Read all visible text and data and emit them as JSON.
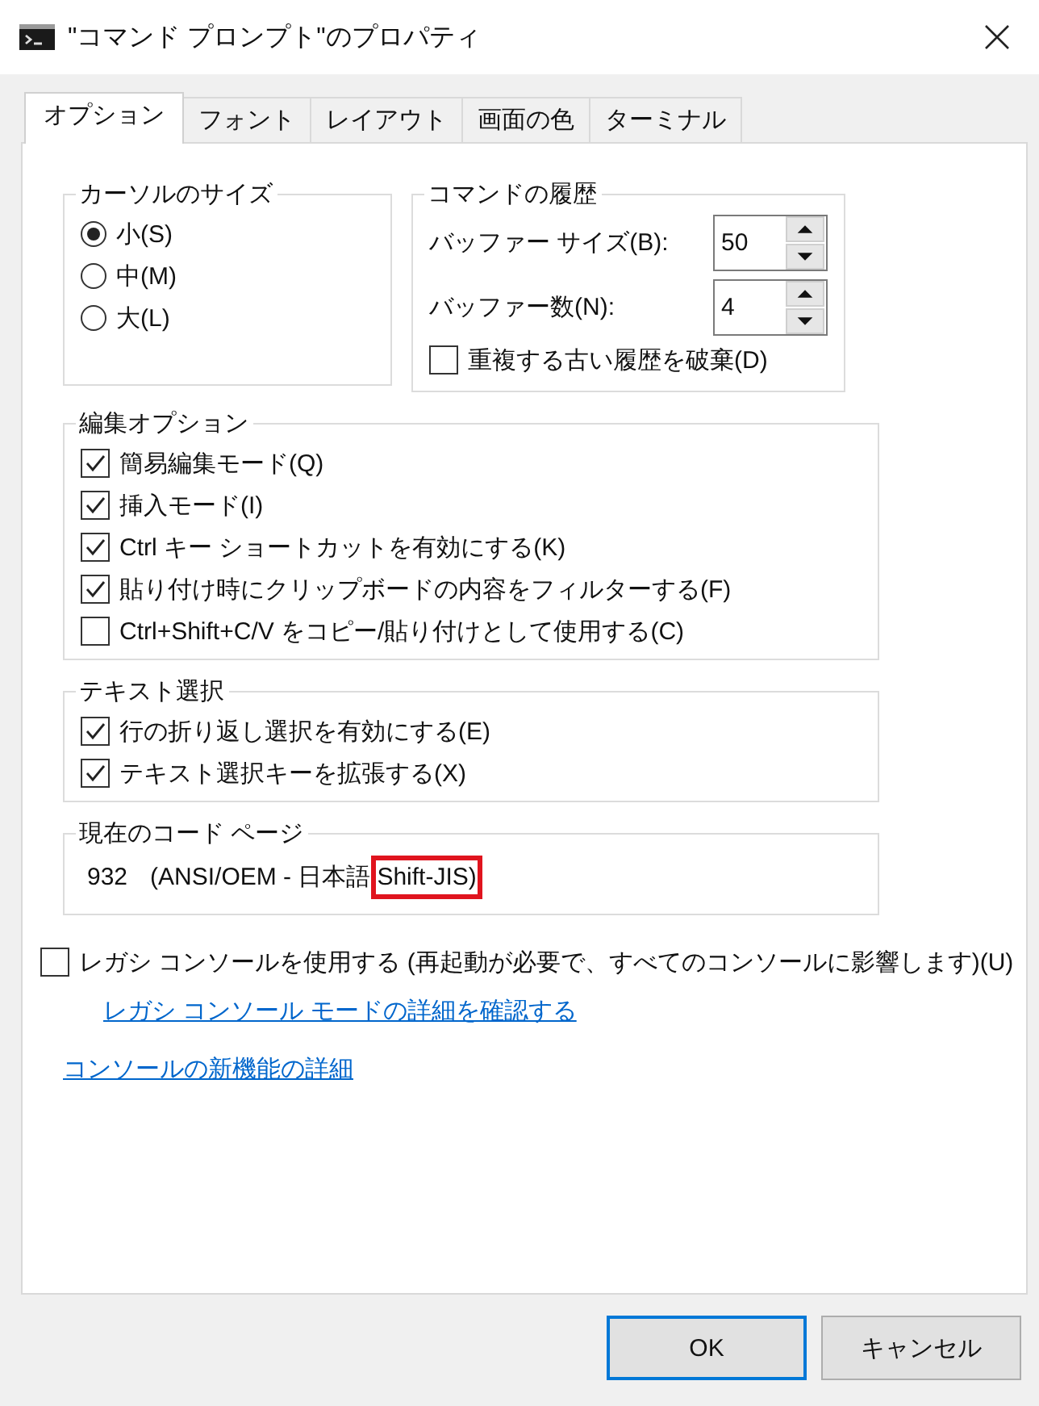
{
  "window": {
    "title": "\"コマンド プロンプト\"のプロパティ"
  },
  "tabs": [
    {
      "label": "オプション",
      "selected": true
    },
    {
      "label": "フォント",
      "selected": false
    },
    {
      "label": "レイアウト",
      "selected": false
    },
    {
      "label": "画面の色",
      "selected": false
    },
    {
      "label": "ターミナル",
      "selected": false
    }
  ],
  "cursor_size": {
    "title": "カーソルのサイズ",
    "options": [
      {
        "label": "小(S)",
        "selected": true
      },
      {
        "label": "中(M)",
        "selected": false
      },
      {
        "label": "大(L)",
        "selected": false
      }
    ]
  },
  "command_history": {
    "title": "コマンドの履歴",
    "spinners": [
      {
        "label": "バッファー サイズ(B):",
        "value": "50"
      },
      {
        "label": "バッファー数(N):",
        "value": "4"
      }
    ],
    "discard_duplicates": {
      "label": "重複する古い履歴を破棄(D)",
      "checked": false
    }
  },
  "edit_options": {
    "title": "編集オプション",
    "items": [
      {
        "label": "簡易編集モード(Q)",
        "checked": true
      },
      {
        "label": "挿入モード(I)",
        "checked": true
      },
      {
        "label": "Ctrl キー ショートカットを有効にする(K)",
        "checked": true
      },
      {
        "label": "貼り付け時にクリップボードの内容をフィルターする(F)",
        "checked": true
      },
      {
        "label": "Ctrl+Shift+C/V をコピー/貼り付けとして使用する(C)",
        "checked": false
      }
    ]
  },
  "text_selection": {
    "title": "テキスト選択",
    "items": [
      {
        "label": "行の折り返し選択を有効にする(E)",
        "checked": true
      },
      {
        "label": "テキスト選択キーを拡張する(X)",
        "checked": true
      }
    ]
  },
  "code_page": {
    "title": "現在のコード ページ",
    "number": "932",
    "description": "(ANSI/OEM - 日本語",
    "highlighted_text": "Shift-JIS)",
    "highlight": true
  },
  "legacy_console": {
    "label": "レガシ コンソールを使用する (再起動が必要で、すべてのコンソールに影響します)(U)",
    "checked": false,
    "link": "レガシ コンソール モードの詳細を確認する"
  },
  "new_features_link": "コンソールの新機能の詳細",
  "buttons": [
    {
      "label": "OK",
      "default": true
    },
    {
      "label": "キャンセル",
      "default": false
    }
  ]
}
